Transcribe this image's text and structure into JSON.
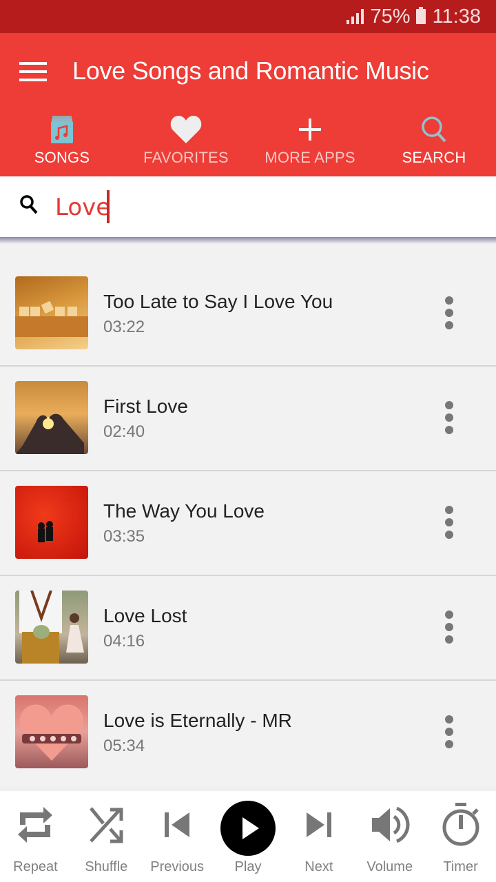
{
  "status_bar": {
    "battery": "75%",
    "time": "11:38"
  },
  "app_bar": {
    "title": "Love Songs and Romantic Music"
  },
  "tabs": [
    {
      "label": "SONGS",
      "icon": "music-album-icon"
    },
    {
      "label": "FAVORITES",
      "icon": "heart-icon"
    },
    {
      "label": "MORE APPS",
      "icon": "plus-icon"
    },
    {
      "label": "SEARCH",
      "icon": "search-icon"
    }
  ],
  "search": {
    "value": "Love",
    "placeholder": ""
  },
  "songs": [
    {
      "title": "Too Late to Say I Love You",
      "duration": "03:22",
      "thumb_colors": [
        "#c98a2e",
        "#f2c27a"
      ]
    },
    {
      "title": "First Love",
      "duration": "02:40",
      "thumb_colors": [
        "#e8a94e",
        "#5a3b2a"
      ]
    },
    {
      "title": "The Way You Love",
      "duration": "03:35",
      "thumb_colors": [
        "#e6220e",
        "#b8120a"
      ]
    },
    {
      "title": "Love Lost",
      "duration": "04:16",
      "thumb_colors": [
        "#c9b49a",
        "#6e7a55"
      ]
    },
    {
      "title": "Love is Eternally - MR",
      "duration": "05:34",
      "thumb_colors": [
        "#f08a7e",
        "#a55c54"
      ]
    }
  ],
  "player": [
    {
      "label": "Repeat",
      "icon": "repeat-icon"
    },
    {
      "label": "Shuffle",
      "icon": "shuffle-icon"
    },
    {
      "label": "Previous",
      "icon": "previous-icon"
    },
    {
      "label": "Play",
      "icon": "play-icon"
    },
    {
      "label": "Next",
      "icon": "next-icon"
    },
    {
      "label": "Volume",
      "icon": "volume-icon"
    },
    {
      "label": "Timer",
      "icon": "timer-icon"
    }
  ],
  "colors": {
    "accent": "#ee3c36",
    "status_bar": "#b71c1c",
    "search_text": "#e53935",
    "icon_gray": "#777777"
  }
}
